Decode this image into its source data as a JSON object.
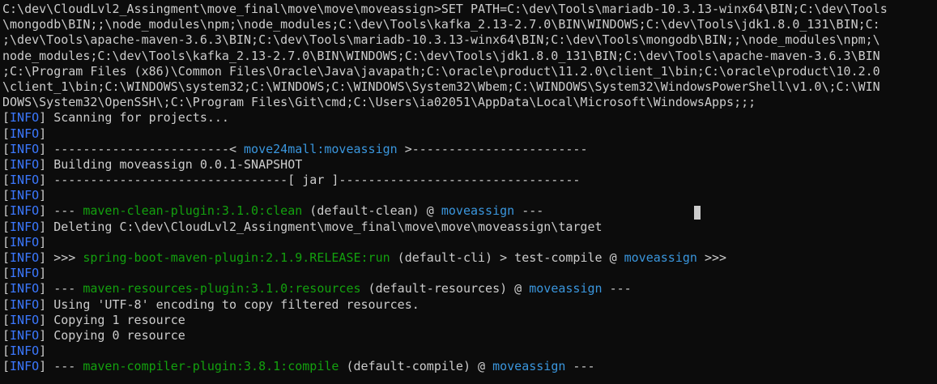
{
  "command_lines": [
    "C:\\dev\\CloudLvl2_Assingment\\move_final\\move\\move\\moveassign>SET PATH=C:\\dev\\Tools\\mariadb-10.3.13-winx64\\BIN;C:\\dev\\Tools",
    "\\mongodb\\BIN;;\\node_modules\\npm;\\node_modules;C:\\dev\\Tools\\kafka_2.13-2.7.0\\BIN\\WINDOWS;C:\\dev\\Tools\\jdk1.8.0_131\\BIN;C:",
    ";\\dev\\Tools\\apache-maven-3.6.3\\BIN;C:\\dev\\Tools\\mariadb-10.3.13-winx64\\BIN;C:\\dev\\Tools\\mongodb\\BIN;;\\node_modules\\npm;\\",
    "node_modules;C:\\dev\\Tools\\kafka_2.13-2.7.0\\BIN\\WINDOWS;C:\\dev\\Tools\\jdk1.8.0_131\\BIN;C:\\dev\\Tools\\apache-maven-3.6.3\\BIN",
    ";C:\\Program Files (x86)\\Common Files\\Oracle\\Java\\javapath;C:\\oracle\\product\\11.2.0\\client_1\\bin;C:\\oracle\\product\\10.2.0",
    "\\client_1\\bin;C:\\WINDOWS\\system32;C:\\WINDOWS;C:\\WINDOWS\\System32\\Wbem;C:\\WINDOWS\\System32\\WindowsPowerShell\\v1.0\\;C:\\WIN",
    "DOWS\\System32\\OpenSSH\\;C:\\Program Files\\Git\\cmd;C:\\Users\\ia02051\\AppData\\Local\\Microsoft\\WindowsApps;;;"
  ],
  "log_prefix": {
    "open": "[",
    "level": "INFO",
    "close": "]"
  },
  "log_lines": [
    {
      "segments": [
        {
          "t": " Scanning for projects...",
          "c": "white"
        }
      ]
    },
    {
      "segments": []
    },
    {
      "segments": [
        {
          "t": " ------------------------< ",
          "c": "white"
        },
        {
          "t": "move24mall:moveassign",
          "c": "cyan"
        },
        {
          "t": " >------------------------",
          "c": "white"
        }
      ]
    },
    {
      "segments": [
        {
          "t": " Building moveassign 0.0.1-SNAPSHOT",
          "c": "white"
        }
      ]
    },
    {
      "segments": [
        {
          "t": " --------------------------------[ jar ]---------------------------------",
          "c": "white"
        }
      ]
    },
    {
      "segments": []
    },
    {
      "segments": [
        {
          "t": " --- ",
          "c": "white"
        },
        {
          "t": "maven-clean-plugin:3.1.0:clean",
          "c": "green"
        },
        {
          "t": " (default-clean) @ ",
          "c": "white"
        },
        {
          "t": "moveassign",
          "c": "cyan"
        },
        {
          "t": " ---",
          "c": "white"
        }
      ]
    },
    {
      "segments": [
        {
          "t": " Deleting C:\\dev\\CloudLvl2_Assingment\\move_final\\move\\move\\moveassign\\target",
          "c": "white"
        }
      ]
    },
    {
      "segments": []
    },
    {
      "segments": [
        {
          "t": " >>> ",
          "c": "white"
        },
        {
          "t": "spring-boot-maven-plugin:2.1.9.RELEASE:run",
          "c": "green"
        },
        {
          "t": " (default-cli) > test-compile @ ",
          "c": "white"
        },
        {
          "t": "moveassign",
          "c": "cyan"
        },
        {
          "t": " >>>",
          "c": "white"
        }
      ]
    },
    {
      "segments": []
    },
    {
      "segments": [
        {
          "t": " --- ",
          "c": "white"
        },
        {
          "t": "maven-resources-plugin:3.1.0:resources",
          "c": "green"
        },
        {
          "t": " (default-resources) @ ",
          "c": "white"
        },
        {
          "t": "moveassign",
          "c": "cyan"
        },
        {
          "t": " ---",
          "c": "white"
        }
      ]
    },
    {
      "segments": [
        {
          "t": " Using 'UTF-8' encoding to copy filtered resources.",
          "c": "white"
        }
      ]
    },
    {
      "segments": [
        {
          "t": " Copying 1 resource",
          "c": "white"
        }
      ]
    },
    {
      "segments": [
        {
          "t": " Copying 0 resource",
          "c": "white"
        }
      ]
    },
    {
      "segments": []
    },
    {
      "segments": [
        {
          "t": " --- ",
          "c": "white"
        },
        {
          "t": "maven-compiler-plugin:3.8.1:compile",
          "c": "green"
        },
        {
          "t": " (default-compile) @ ",
          "c": "white"
        },
        {
          "t": "moveassign",
          "c": "cyan"
        },
        {
          "t": " ---",
          "c": "white"
        }
      ]
    }
  ],
  "colors": {
    "background": "#0c0c0c",
    "foreground": "#cccccc",
    "info_blue": "#3b78ff",
    "plugin_green": "#13a10e",
    "artifact_cyan": "#3a96dd"
  }
}
